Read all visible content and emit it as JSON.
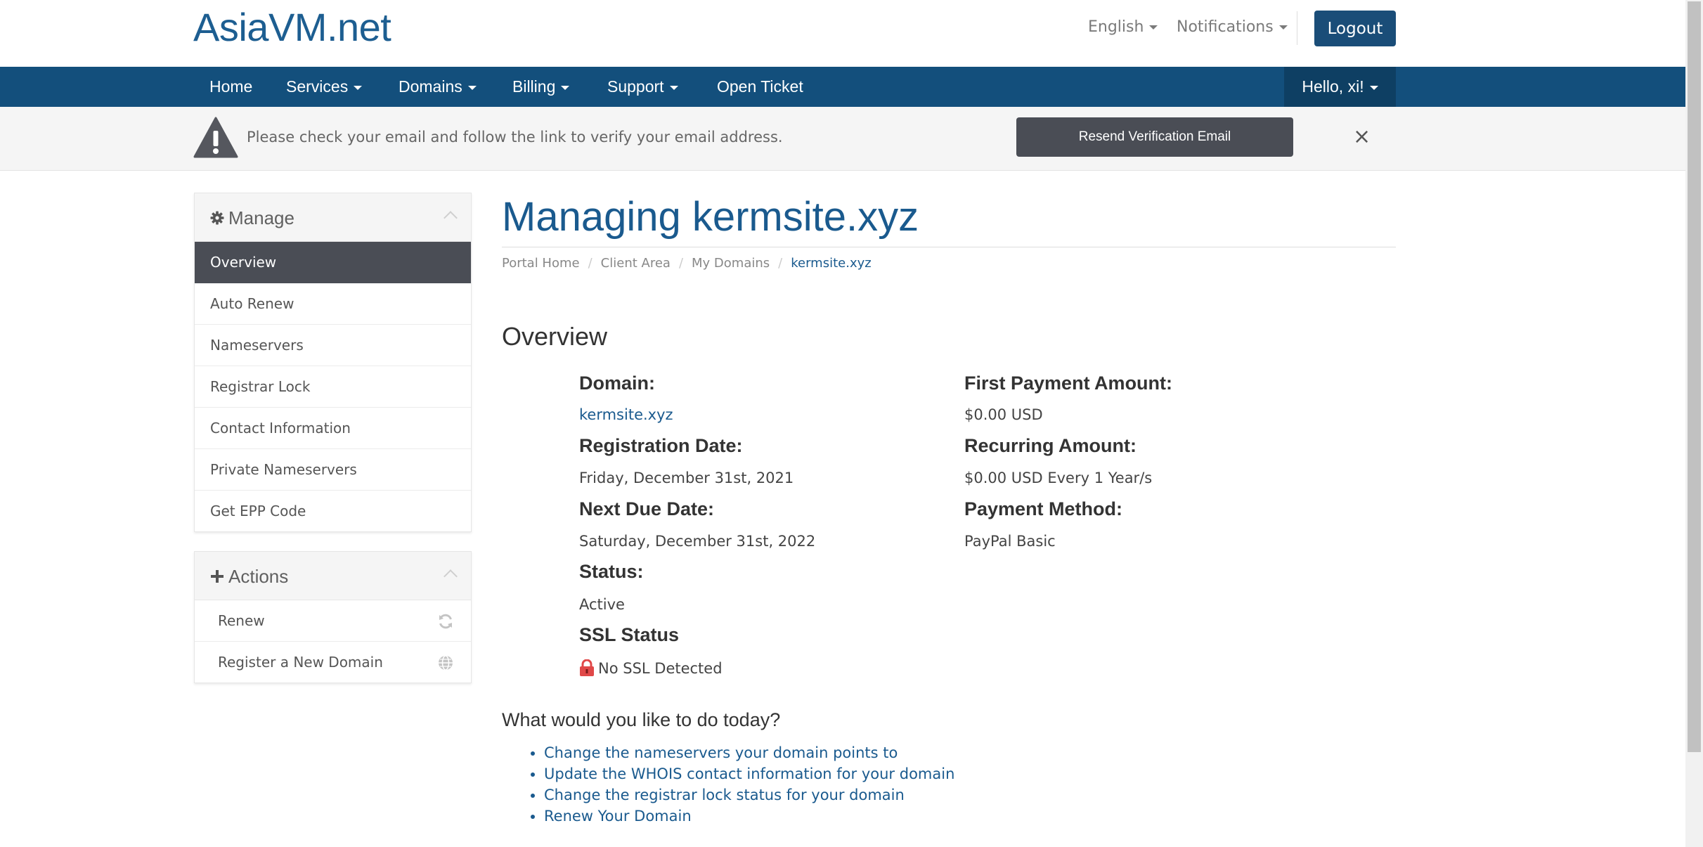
{
  "header": {
    "logo": "AsiaVM.net",
    "language": "English",
    "notifications": "Notifications",
    "logout": "Logout"
  },
  "nav": {
    "items": [
      "Home",
      "Services",
      "Domains",
      "Billing",
      "Support",
      "Open Ticket"
    ],
    "greeting": "Hello, xi!"
  },
  "alert": {
    "message": "Please check your email and follow the link to verify your email address.",
    "button": "Resend Verification Email",
    "close": "×"
  },
  "sidebar": {
    "manage": {
      "title": "Manage",
      "items": [
        "Overview",
        "Auto Renew",
        "Nameservers",
        "Registrar Lock",
        "Contact Information",
        "Private Nameservers",
        "Get EPP Code"
      ]
    },
    "actions": {
      "title": "Actions",
      "items": [
        "Renew",
        "Register a New Domain"
      ]
    }
  },
  "main": {
    "title": "Managing kermsite.xyz",
    "breadcrumb": [
      "Portal Home",
      "Client Area",
      "My Domains",
      "kermsite.xyz"
    ],
    "overview_title": "Overview",
    "fields": {
      "domain_label": "Domain:",
      "domain_value": "kermsite.xyz",
      "reg_date_label": "Registration Date:",
      "reg_date_value": "Friday, December 31st, 2021",
      "next_due_label": "Next Due Date:",
      "next_due_value": "Saturday, December 31st, 2022",
      "status_label": "Status:",
      "status_value": "Active",
      "ssl_label": "SSL Status",
      "ssl_value": "No SSL Detected",
      "first_payment_label": "First Payment Amount:",
      "first_payment_value": "$0.00 USD",
      "recurring_label": "Recurring Amount:",
      "recurring_value": "$0.00 USD Every 1 Year/s",
      "payment_method_label": "Payment Method:",
      "payment_method_value": "PayPal Basic"
    },
    "todo_title": "What would you like to do today?",
    "todo_links": [
      "Change the nameservers your domain points to",
      "Update the WHOIS contact information for your domain",
      "Change the registrar lock status for your domain",
      "Renew Your Domain"
    ]
  },
  "colors": {
    "brand": "#1a5a8e",
    "navbar": "#134f7c",
    "active_menu": "#4a4d55"
  },
  "icons": [
    "warning-icon",
    "gear-icon",
    "plus-icon",
    "refresh-icon",
    "globe-icon",
    "lock-icon",
    "close-icon",
    "chevron-up-icon",
    "caret-down-icon"
  ]
}
